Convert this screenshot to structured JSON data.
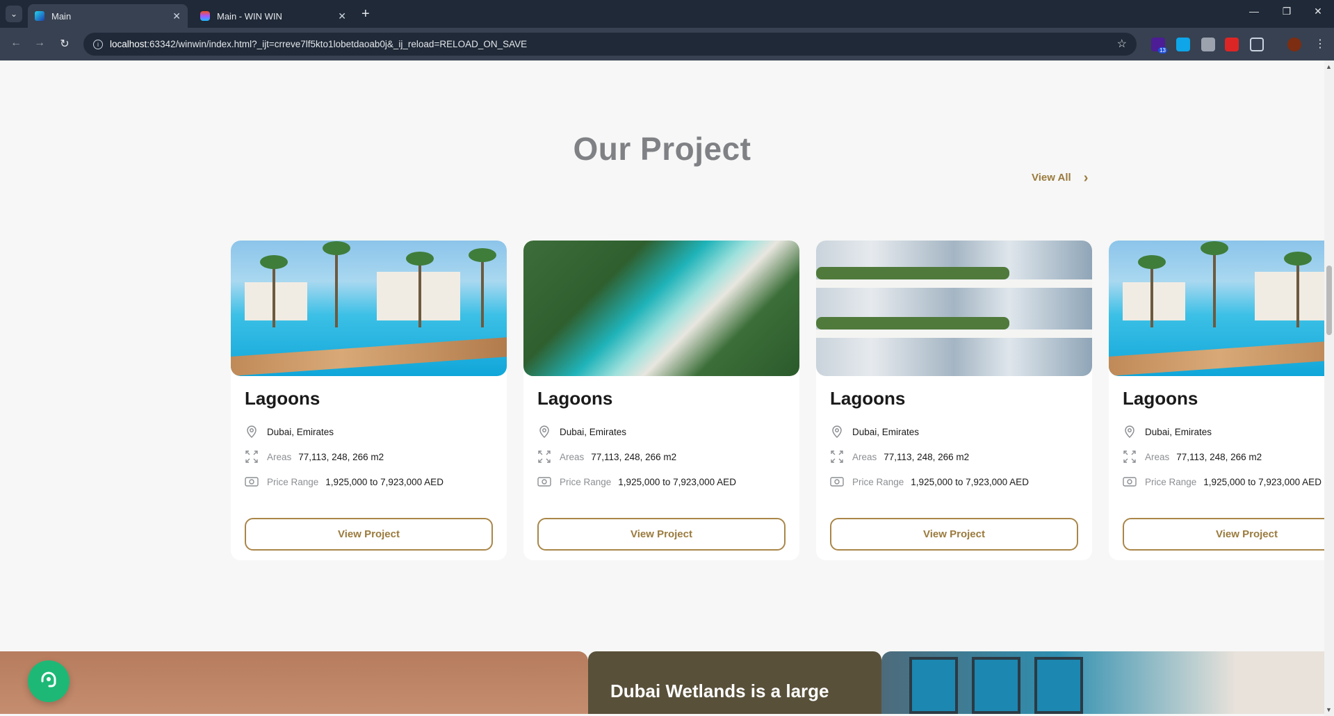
{
  "browser": {
    "tabs": [
      {
        "title": "Main",
        "active": true
      },
      {
        "title": "Main - WIN WIN",
        "active": false
      }
    ],
    "url_host": "localhost",
    "url_rest": ":63342/winwin/index.html?_ijt=crreve7lf5kto1lobetdaoab0j&_ij_reload=RELOAD_ON_SAVE",
    "extension_badge": "13"
  },
  "section": {
    "title": "Our Project",
    "view_all": "View All"
  },
  "cards": [
    {
      "name": "Lagoons",
      "location": "Dubai, Emirates",
      "areas_label": "Areas",
      "areas": "77,113, 248, 266 m2",
      "price_label": "Price Range",
      "price": "1,925,000 to 7,923,000 AED",
      "button": "View Project",
      "image": "pool"
    },
    {
      "name": "Lagoons",
      "location": "Dubai, Emirates",
      "areas_label": "Areas",
      "areas": "77,113, 248, 266 m2",
      "price_label": "Price Range",
      "price": "1,925,000 to 7,923,000 AED",
      "button": "View Project",
      "image": "aerial"
    },
    {
      "name": "Lagoons",
      "location": "Dubai, Emirates",
      "areas_label": "Areas",
      "areas": "77,113, 248, 266 m2",
      "price_label": "Price Range",
      "price": "1,925,000 to 7,923,000 AED",
      "button": "View Project",
      "image": "tower"
    },
    {
      "name": "Lagoons",
      "location": "Dubai, Emirates",
      "areas_label": "Areas",
      "areas": "77,113, 248, 266 m2",
      "price_label": "Price Range",
      "price": "1,925,000 to 7,923,000 AED",
      "button": "View Project",
      "image": "pool"
    }
  ],
  "promo": {
    "headline": "Dubai Wetlands is a large"
  },
  "colors": {
    "accent": "#9a7a3d",
    "support": "#1eb876",
    "promo_bg": "#59503a"
  }
}
